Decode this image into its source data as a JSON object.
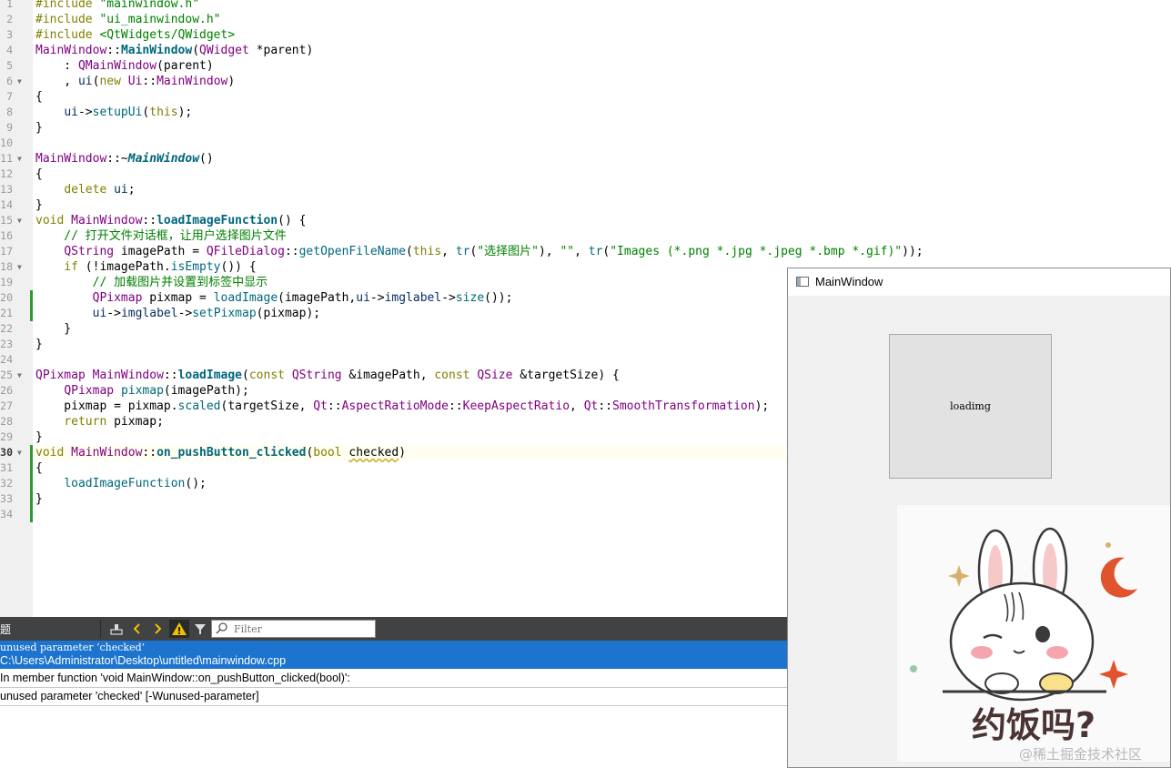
{
  "editor": {
    "gutter": [
      {
        "n": "1",
        "fold": ""
      },
      {
        "n": "2",
        "fold": ""
      },
      {
        "n": "3",
        "fold": ""
      },
      {
        "n": "4",
        "fold": ""
      },
      {
        "n": "5",
        "fold": ""
      },
      {
        "n": "6",
        "fold": "▼"
      },
      {
        "n": "7",
        "fold": ""
      },
      {
        "n": "8",
        "fold": ""
      },
      {
        "n": "9",
        "fold": ""
      },
      {
        "n": "10",
        "fold": ""
      },
      {
        "n": "11",
        "fold": "▼"
      },
      {
        "n": "12",
        "fold": ""
      },
      {
        "n": "13",
        "fold": ""
      },
      {
        "n": "14",
        "fold": ""
      },
      {
        "n": "15",
        "fold": "▼"
      },
      {
        "n": "16",
        "fold": ""
      },
      {
        "n": "17",
        "fold": ""
      },
      {
        "n": "18",
        "fold": "▼"
      },
      {
        "n": "19",
        "fold": ""
      },
      {
        "n": "20",
        "fold": ""
      },
      {
        "n": "21",
        "fold": ""
      },
      {
        "n": "22",
        "fold": ""
      },
      {
        "n": "23",
        "fold": ""
      },
      {
        "n": "24",
        "fold": ""
      },
      {
        "n": "25",
        "fold": "▼"
      },
      {
        "n": "26",
        "fold": ""
      },
      {
        "n": "27",
        "fold": ""
      },
      {
        "n": "28",
        "fold": ""
      },
      {
        "n": "29",
        "fold": ""
      },
      {
        "n": "30",
        "fold": "▼"
      },
      {
        "n": "31",
        "fold": ""
      },
      {
        "n": "32",
        "fold": ""
      },
      {
        "n": "33",
        "fold": ""
      },
      {
        "n": "34",
        "fold": ""
      }
    ],
    "current_line": "30",
    "modified_lines": [
      "20",
      "21",
      "30",
      "31",
      "32",
      "33",
      "34"
    ],
    "lines": [
      [
        [
          "k",
          "#include"
        ],
        [
          "",
          " "
        ],
        [
          "s",
          "\"mainwindow.h\""
        ]
      ],
      [
        [
          "k",
          "#include"
        ],
        [
          "",
          " "
        ],
        [
          "s",
          "\"ui_mainwindow.h\""
        ]
      ],
      [
        [
          "k",
          "#include"
        ],
        [
          "",
          " "
        ],
        [
          "s",
          "<QtWidgets/QWidget>"
        ]
      ],
      [
        [
          "t",
          "MainWindow"
        ],
        [
          "",
          "::"
        ],
        [
          "fb",
          "MainWindow"
        ],
        [
          "",
          "("
        ],
        [
          "t",
          "QWidget"
        ],
        [
          "",
          " *parent)"
        ]
      ],
      [
        [
          "",
          "    : "
        ],
        [
          "t",
          "QMainWindow"
        ],
        [
          "",
          "(parent)"
        ]
      ],
      [
        [
          "",
          "    , "
        ],
        [
          "m",
          "ui"
        ],
        [
          "",
          "("
        ],
        [
          "k",
          "new"
        ],
        [
          "",
          " "
        ],
        [
          "t",
          "Ui"
        ],
        [
          "",
          "::"
        ],
        [
          "t",
          "MainWindow"
        ],
        [
          "",
          ")"
        ]
      ],
      [
        [
          "",
          "{"
        ]
      ],
      [
        [
          "",
          "    "
        ],
        [
          "m",
          "ui"
        ],
        [
          "",
          "->"
        ],
        [
          "f",
          "setupUi"
        ],
        [
          "",
          "("
        ],
        [
          "k",
          "this"
        ],
        [
          "",
          ");"
        ]
      ],
      [
        [
          "",
          "}"
        ]
      ],
      [],
      [
        [
          "t",
          "MainWindow"
        ],
        [
          "",
          "::~"
        ],
        [
          "fi",
          "MainWindow"
        ],
        [
          "",
          "()"
        ]
      ],
      [
        [
          "",
          "{"
        ]
      ],
      [
        [
          "",
          "    "
        ],
        [
          "k",
          "delete"
        ],
        [
          "",
          " "
        ],
        [
          "m",
          "ui"
        ],
        [
          "",
          ";"
        ]
      ],
      [
        [
          "",
          "}"
        ]
      ],
      [
        [
          "k",
          "void"
        ],
        [
          "",
          " "
        ],
        [
          "t",
          "MainWindow"
        ],
        [
          "",
          "::"
        ],
        [
          "fb",
          "loadImageFunction"
        ],
        [
          "",
          "() {"
        ]
      ],
      [
        [
          "c",
          "    // 打开文件对话框，让用户选择图片文件"
        ]
      ],
      [
        [
          "",
          "    "
        ],
        [
          "t",
          "QString"
        ],
        [
          "",
          " imagePath = "
        ],
        [
          "t",
          "QFileDialog"
        ],
        [
          "",
          "::"
        ],
        [
          "f",
          "getOpenFileName"
        ],
        [
          "",
          "("
        ],
        [
          "k",
          "this"
        ],
        [
          "",
          ", "
        ],
        [
          "f",
          "tr"
        ],
        [
          "",
          "("
        ],
        [
          "s",
          "\"选择图片\""
        ],
        [
          "",
          "), "
        ],
        [
          "s",
          "\"\""
        ],
        [
          "",
          ", "
        ],
        [
          "f",
          "tr"
        ],
        [
          "",
          "("
        ],
        [
          "s",
          "\"Images (*.png *.jpg *.jpeg *.bmp *.gif)\""
        ],
        [
          "",
          "));"
        ]
      ],
      [
        [
          "",
          "    "
        ],
        [
          "k",
          "if"
        ],
        [
          "",
          " (!imagePath."
        ],
        [
          "f",
          "isEmpty"
        ],
        [
          "",
          "()) {"
        ]
      ],
      [
        [
          "c",
          "        // 加载图片并设置到标签中显示"
        ]
      ],
      [
        [
          "",
          "        "
        ],
        [
          "t",
          "QPixmap"
        ],
        [
          "",
          " pixmap = "
        ],
        [
          "f",
          "loadImage"
        ],
        [
          "",
          "(imagePath,"
        ],
        [
          "m",
          "ui"
        ],
        [
          "",
          "->"
        ],
        [
          "m",
          "imglabel"
        ],
        [
          "",
          "->"
        ],
        [
          "f",
          "size"
        ],
        [
          "",
          "());"
        ]
      ],
      [
        [
          "",
          "        "
        ],
        [
          "m",
          "ui"
        ],
        [
          "",
          "->"
        ],
        [
          "m",
          "imglabel"
        ],
        [
          "",
          "->"
        ],
        [
          "f",
          "setPixmap"
        ],
        [
          "",
          "(pixmap);"
        ]
      ],
      [
        [
          "",
          "    }"
        ]
      ],
      [
        [
          "",
          "}"
        ]
      ],
      [],
      [
        [
          "t",
          "QPixmap"
        ],
        [
          "",
          " "
        ],
        [
          "t",
          "MainWindow"
        ],
        [
          "",
          "::"
        ],
        [
          "fb",
          "loadImage"
        ],
        [
          "",
          "("
        ],
        [
          "k",
          "const"
        ],
        [
          "",
          " "
        ],
        [
          "t",
          "QString"
        ],
        [
          "",
          " &imagePath, "
        ],
        [
          "k",
          "const"
        ],
        [
          "",
          " "
        ],
        [
          "t",
          "QSize"
        ],
        [
          "",
          " &targetSize) {"
        ]
      ],
      [
        [
          "",
          "    "
        ],
        [
          "t",
          "QPixmap"
        ],
        [
          "",
          " "
        ],
        [
          "f",
          "pixmap"
        ],
        [
          "",
          "(imagePath);"
        ]
      ],
      [
        [
          "",
          "    pixmap = pixmap."
        ],
        [
          "f",
          "scaled"
        ],
        [
          "",
          "(targetSize, "
        ],
        [
          "t",
          "Qt"
        ],
        [
          "",
          "::"
        ],
        [
          "t",
          "AspectRatioMode"
        ],
        [
          "",
          "::"
        ],
        [
          "t",
          "KeepAspectRatio"
        ],
        [
          "",
          ", "
        ],
        [
          "t",
          "Qt"
        ],
        [
          "",
          "::"
        ],
        [
          "t",
          "SmoothTransformation"
        ],
        [
          "",
          ");"
        ]
      ],
      [
        [
          "",
          "    "
        ],
        [
          "k",
          "return"
        ],
        [
          "",
          " pixmap;"
        ]
      ],
      [
        [
          "",
          "}"
        ]
      ],
      [
        [
          "k",
          "void"
        ],
        [
          "",
          " "
        ],
        [
          "t",
          "MainWindow"
        ],
        [
          "",
          "::"
        ],
        [
          "fb",
          "on_pushButton_clicked"
        ],
        [
          "",
          "("
        ],
        [
          "k",
          "bool"
        ],
        [
          "",
          " "
        ],
        [
          "und",
          "checked"
        ],
        [
          "",
          ")"
        ]
      ],
      [
        [
          "",
          "{"
        ]
      ],
      [
        [
          "",
          "    "
        ],
        [
          "f",
          "loadImageFunction"
        ],
        [
          "",
          "();"
        ]
      ],
      [
        [
          "",
          "}"
        ]
      ],
      []
    ]
  },
  "issues": {
    "title_fragment": "题",
    "filter_placeholder": "Filter",
    "selected": {
      "line1": "unused parameter ‘checked’",
      "line2": "C:\\Users\\Administrator\\Desktop\\untitled\\mainwindow.cpp"
    },
    "rows": [
      "In member function 'void MainWindow::on_pushButton_clicked(bool)':",
      "unused parameter 'checked' [-Wunused-parameter]"
    ],
    "toolbar_icons": [
      "clean-icon",
      "prev-arrow-icon",
      "next-arrow-icon",
      "warning-icon",
      "filter-icon",
      "search-icon"
    ]
  },
  "app_window": {
    "title": "MainWindow",
    "label_text": "loadimg",
    "image_caption": "约饭吗?"
  },
  "watermark": "@稀土掘金技术社区",
  "colors": {
    "keyword": "#808000",
    "string": "#008000",
    "type": "#800080",
    "function": "#00677c",
    "selection": "#1d74cf",
    "toolbar": "#404244"
  }
}
